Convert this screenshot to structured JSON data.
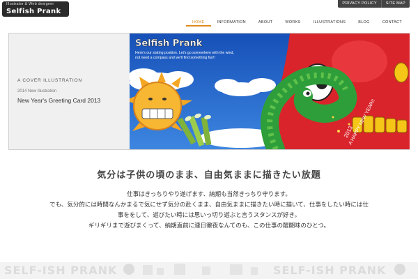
{
  "header": {
    "logo_tagline": "Illustrator & Web designer",
    "logo_name": "Selfish Prank"
  },
  "util_nav": [
    "PRIVACY POLICY",
    "SITE MAP"
  ],
  "main_nav": {
    "items": [
      "HOME",
      "INFORMATION",
      "ABOUT",
      "WORKS",
      "ILLUSTRATIONS",
      "BLOG",
      "CONTACT"
    ],
    "active": "HOME"
  },
  "hero": {
    "label": "A COVER ILLUSTRATION",
    "sub": "2014 New Illustration",
    "title": "New Year's Greeting Card 2013",
    "art": {
      "brand": "Selfish Prank",
      "caption_line1": "Here's our stating position. Let's go somewhere with the wind,",
      "caption_line2": "not need a compass and we'll find something fun!!",
      "greeting_year": "2013",
      "greeting_text": "A HAPPY NEW YEAR!!"
    }
  },
  "content": {
    "heading": "気分は子供の頃のまま、自由気ままに描きたい放題",
    "lines": [
      "仕事はきっちりやり遂げます、納期も当然きっちり守ります。",
      "でも、気分的には時間なんかまるで気にせず気分の赴くまま、自由気ままに描きたい時に描いて、仕事をしたい時には仕",
      "事ををして、遊びたい時には思いっ切り遊ぶと言うスタンスが好き。",
      "ギリギリまで遊びまくって、納期直前に連日徹夜なんてのも、この仕事の醍醐味のひとつ。"
    ]
  },
  "footer": {
    "brand_repeat": "SELF-ISH PRANK"
  },
  "colors": {
    "accent": "#e0891b",
    "sky": "#1f5fc4",
    "sun": "#f5a623",
    "snake": "#2e9e3a",
    "red": "#d9242b"
  }
}
